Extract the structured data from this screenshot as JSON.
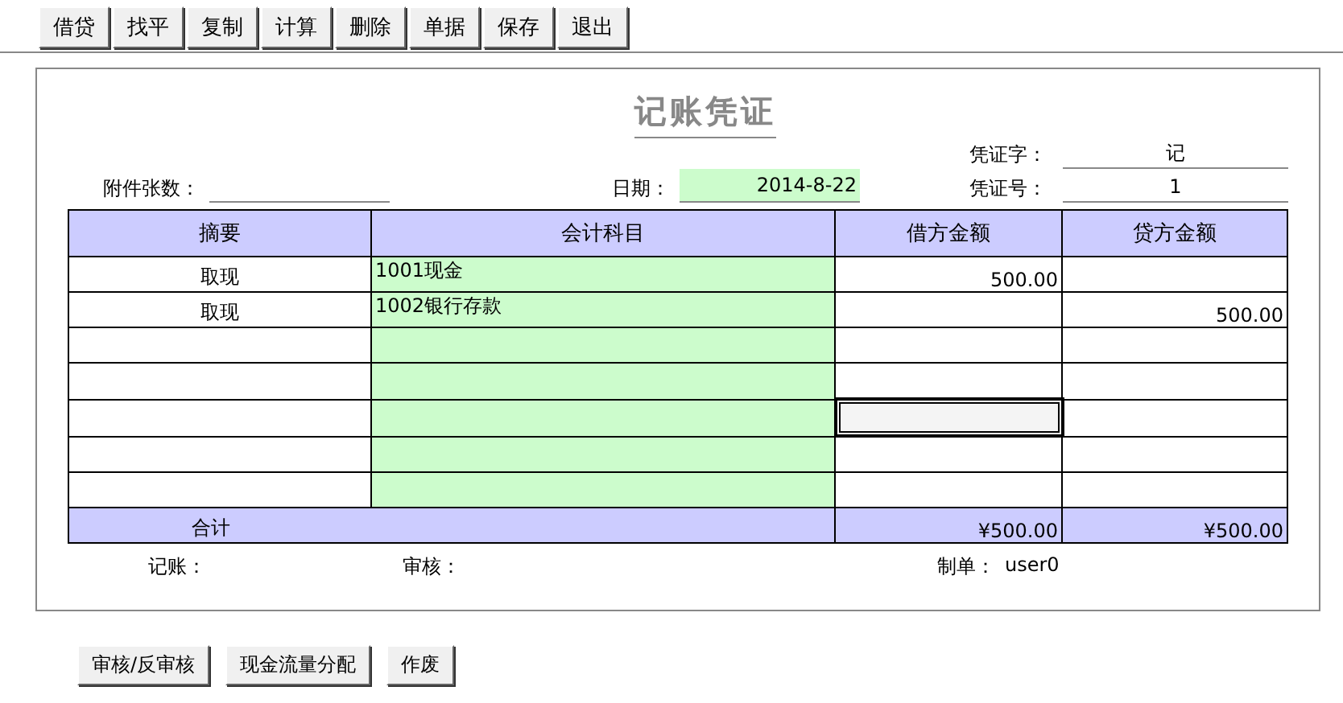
{
  "toolbar": [
    "借贷",
    "找平",
    "复制",
    "计算",
    "删除",
    "单据",
    "保存",
    "退出"
  ],
  "voucher": {
    "title": "记账凭证",
    "attachments": {
      "label": "附件张数："
    },
    "date": {
      "label": "日期：",
      "value": "2014-8-22"
    },
    "voucher_word": {
      "label": "凭证字：",
      "value": "记"
    },
    "voucher_no": {
      "label": "凭证号：",
      "value": "1"
    },
    "table": {
      "columns": [
        "摘要",
        "会计科目",
        "借方金额",
        "贷方金额"
      ],
      "rows": [
        {
          "summary": "取现",
          "account": "1001现金",
          "debit": "500.00",
          "debit_focused": false
        },
        {
          "summary": "取现",
          "account": "1002银行存款",
          "credit": "500.00",
          "debit_focused": false
        },
        {
          "debit_focused": false
        },
        {
          "debit_focused": false
        },
        {
          "debit_focused": true
        },
        {
          "debit_focused": false
        },
        {
          "debit_focused": false
        }
      ],
      "total": {
        "label": "合计",
        "debit": "¥500.00",
        "credit": "¥500.00"
      }
    },
    "footer": [
      {
        "label": "记账："
      },
      {
        "label": "审核："
      },
      {
        "label": "制单：",
        "value": "user0"
      }
    ]
  },
  "actions": [
    "审核/反审核",
    "现金流量分配",
    "作废"
  ]
}
